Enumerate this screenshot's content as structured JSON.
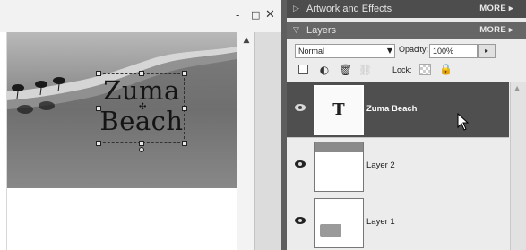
{
  "window": {
    "minimize_glyph": "-",
    "maximize_glyph": "□",
    "close_glyph": "✕"
  },
  "canvas": {
    "text_layer": {
      "line1": "Zuma",
      "line2": "Beach"
    }
  },
  "panel": {
    "artwork_section": {
      "title": "Artwork and Effects",
      "more": "MORE ▸",
      "expanded": false
    },
    "layers_section": {
      "title": "Layers",
      "more": "MORE ▸",
      "expanded": true
    },
    "blend_mode": {
      "value": "Normal"
    },
    "opacity": {
      "label": "Opacity:",
      "value": "100%"
    },
    "lock": {
      "label": "Lock:"
    },
    "layers": [
      {
        "name": "Zuma Beach",
        "type": "text",
        "thumb_glyph": "T",
        "selected": true,
        "visible": true
      },
      {
        "name": "Layer 2",
        "type": "image",
        "selected": false,
        "visible": true
      },
      {
        "name": "Layer 1",
        "type": "image",
        "selected": false,
        "visible": true
      }
    ]
  },
  "colors": {
    "selected_layer_bg": "#4f4f4f",
    "section_bar_bg": "#5a5a5a",
    "panel_bg": "#e9e9e9"
  }
}
